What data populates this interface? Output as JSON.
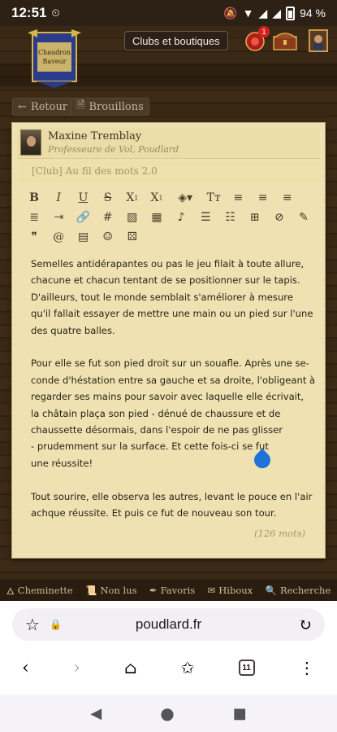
{
  "status": {
    "time": "12:51",
    "battery": "94 %"
  },
  "header": {
    "club_button": "Clubs et boutiques",
    "notif_count": "1"
  },
  "nav": {
    "back": "Retour",
    "drafts": "Brouillons"
  },
  "post": {
    "author": "Maxine Tremblay",
    "role": "Professeure de Vol, Poudlard",
    "subject": "[Club] Au fil des mots 2.0",
    "lines": [
      [
        "Semelles antidérapantes ou pas le jeu filait à toute allure,",
        "chacune et chacun tentant de se positionner sur le tapis.",
        "D'ailleurs, tout le monde semblait s'améliorer à mesure",
        "qu'il fallait essayer de mettre une main ou un pied sur l'une",
        "des quatre balles."
      ],
      [
        "Pour elle se fut son pied droit sur un souafle. Après une se-",
        "conde d'héstation entre sa gauche et sa droite, l'obligeant à",
        "regarder ses mains pour savoir avec laquelle elle écrivait,",
        "la châtain plaça son pied - dénué de chaussure et de",
        "chaussette désormais, dans l'espoir de ne pas glisser",
        "- prudemment sur la surface. Et cette fois-ci se fut",
        "une réussite!"
      ],
      [
        "Tout sourire, elle observa les autres, levant le pouce en l'air",
        "achque réussite. Et puis ce fut de nouveau son tour."
      ]
    ],
    "wordcount": "(126 mots)"
  },
  "sitenav": [
    "Cheminette",
    "Non lus",
    "Favoris",
    "Hiboux",
    "Recherche"
  ],
  "browser": {
    "url": "poudlard.fr",
    "tabs": "11"
  }
}
